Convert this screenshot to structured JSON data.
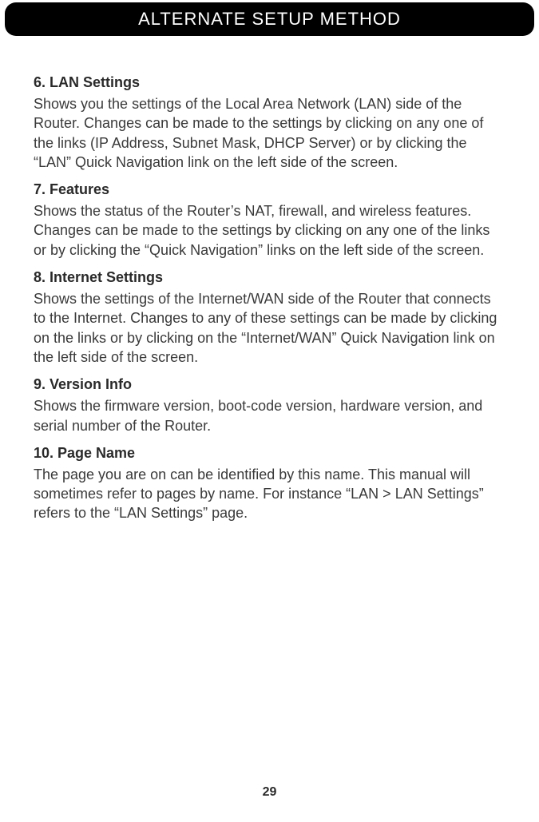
{
  "header_title": "ALTERNATE SETUP METHOD",
  "sections": [
    {
      "heading": "6. LAN Settings",
      "body": "Shows you the settings of the Local Area Network (LAN) side of the Router. Changes can be made to the settings by clicking on any one of the links (IP Address, Subnet Mask, DHCP Server) or by clicking the “LAN” Quick Navigation link on the left side of the screen."
    },
    {
      "heading": "7. Features",
      "body": "Shows the status of the Router’s NAT, firewall, and wireless features. Changes can be made to the settings by clicking on any one of the links or by clicking the “Quick Navigation” links on the left side of the screen."
    },
    {
      "heading": "8. Internet Settings",
      "body": "Shows the settings of the Internet/WAN side of the Router that connects to the Internet. Changes to any of these settings can be made by clicking on the links or by clicking on the “Internet/WAN” Quick Navigation link on the left side of the screen."
    },
    {
      "heading": "9. Version Info",
      "body": "Shows the firmware version, boot-code version, hardware version, and serial number of the Router."
    },
    {
      "heading": "10. Page Name",
      "body": "The page you are on can be identified by this name. This manual will sometimes refer to pages by name. For instance “LAN > LAN Settings” refers to the “LAN Settings” page."
    }
  ],
  "page_number": "29"
}
